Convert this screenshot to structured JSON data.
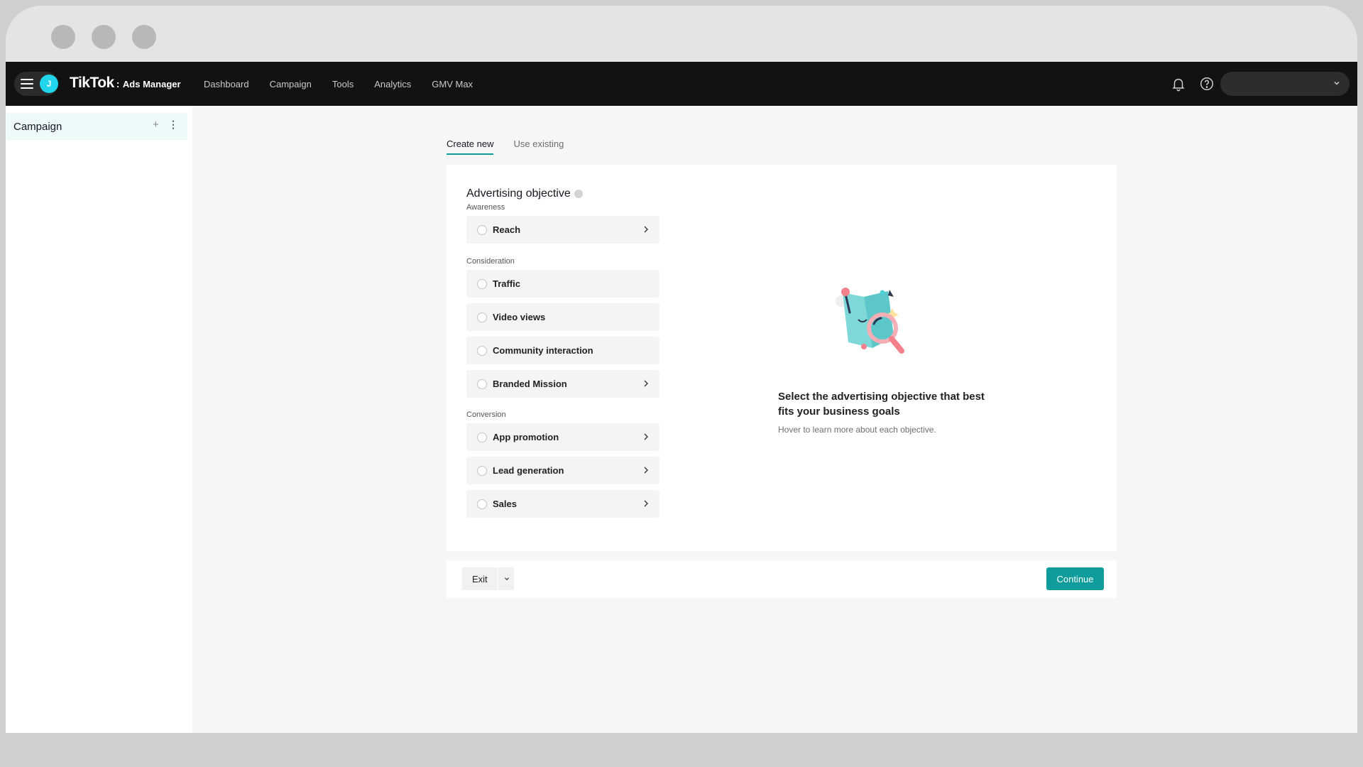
{
  "app": {
    "brand_main": "TikTok",
    "brand_sep": ":",
    "brand_sub": "Ads Manager",
    "avatar_letter": "J",
    "accent_color": "#0e9c9c"
  },
  "nav": {
    "items": [
      "Dashboard",
      "Campaign",
      "Tools",
      "Analytics",
      "GMV Max"
    ]
  },
  "sidebar": {
    "item_label": "Campaign",
    "add_icon": "plus-icon",
    "more_icon": "more-vertical-icon"
  },
  "tabs": [
    "Create new",
    "Use existing"
  ],
  "objective": {
    "title": "Advertising objective",
    "groups": [
      "Awareness",
      "Consideration",
      "Conversion"
    ],
    "options": [
      "Reach",
      "Traffic",
      "Video views",
      "Community interaction",
      "Branded Mission",
      "App promotion",
      "Lead generation",
      "Sales"
    ]
  },
  "hint": {
    "title": "Select the advertising objective that best fits your business goals",
    "subtitle": "Hover to learn more about each objective."
  },
  "footer": {
    "exit_label": "Exit",
    "continue_label": "Continue"
  },
  "floating": {
    "help_glyph": "?"
  }
}
